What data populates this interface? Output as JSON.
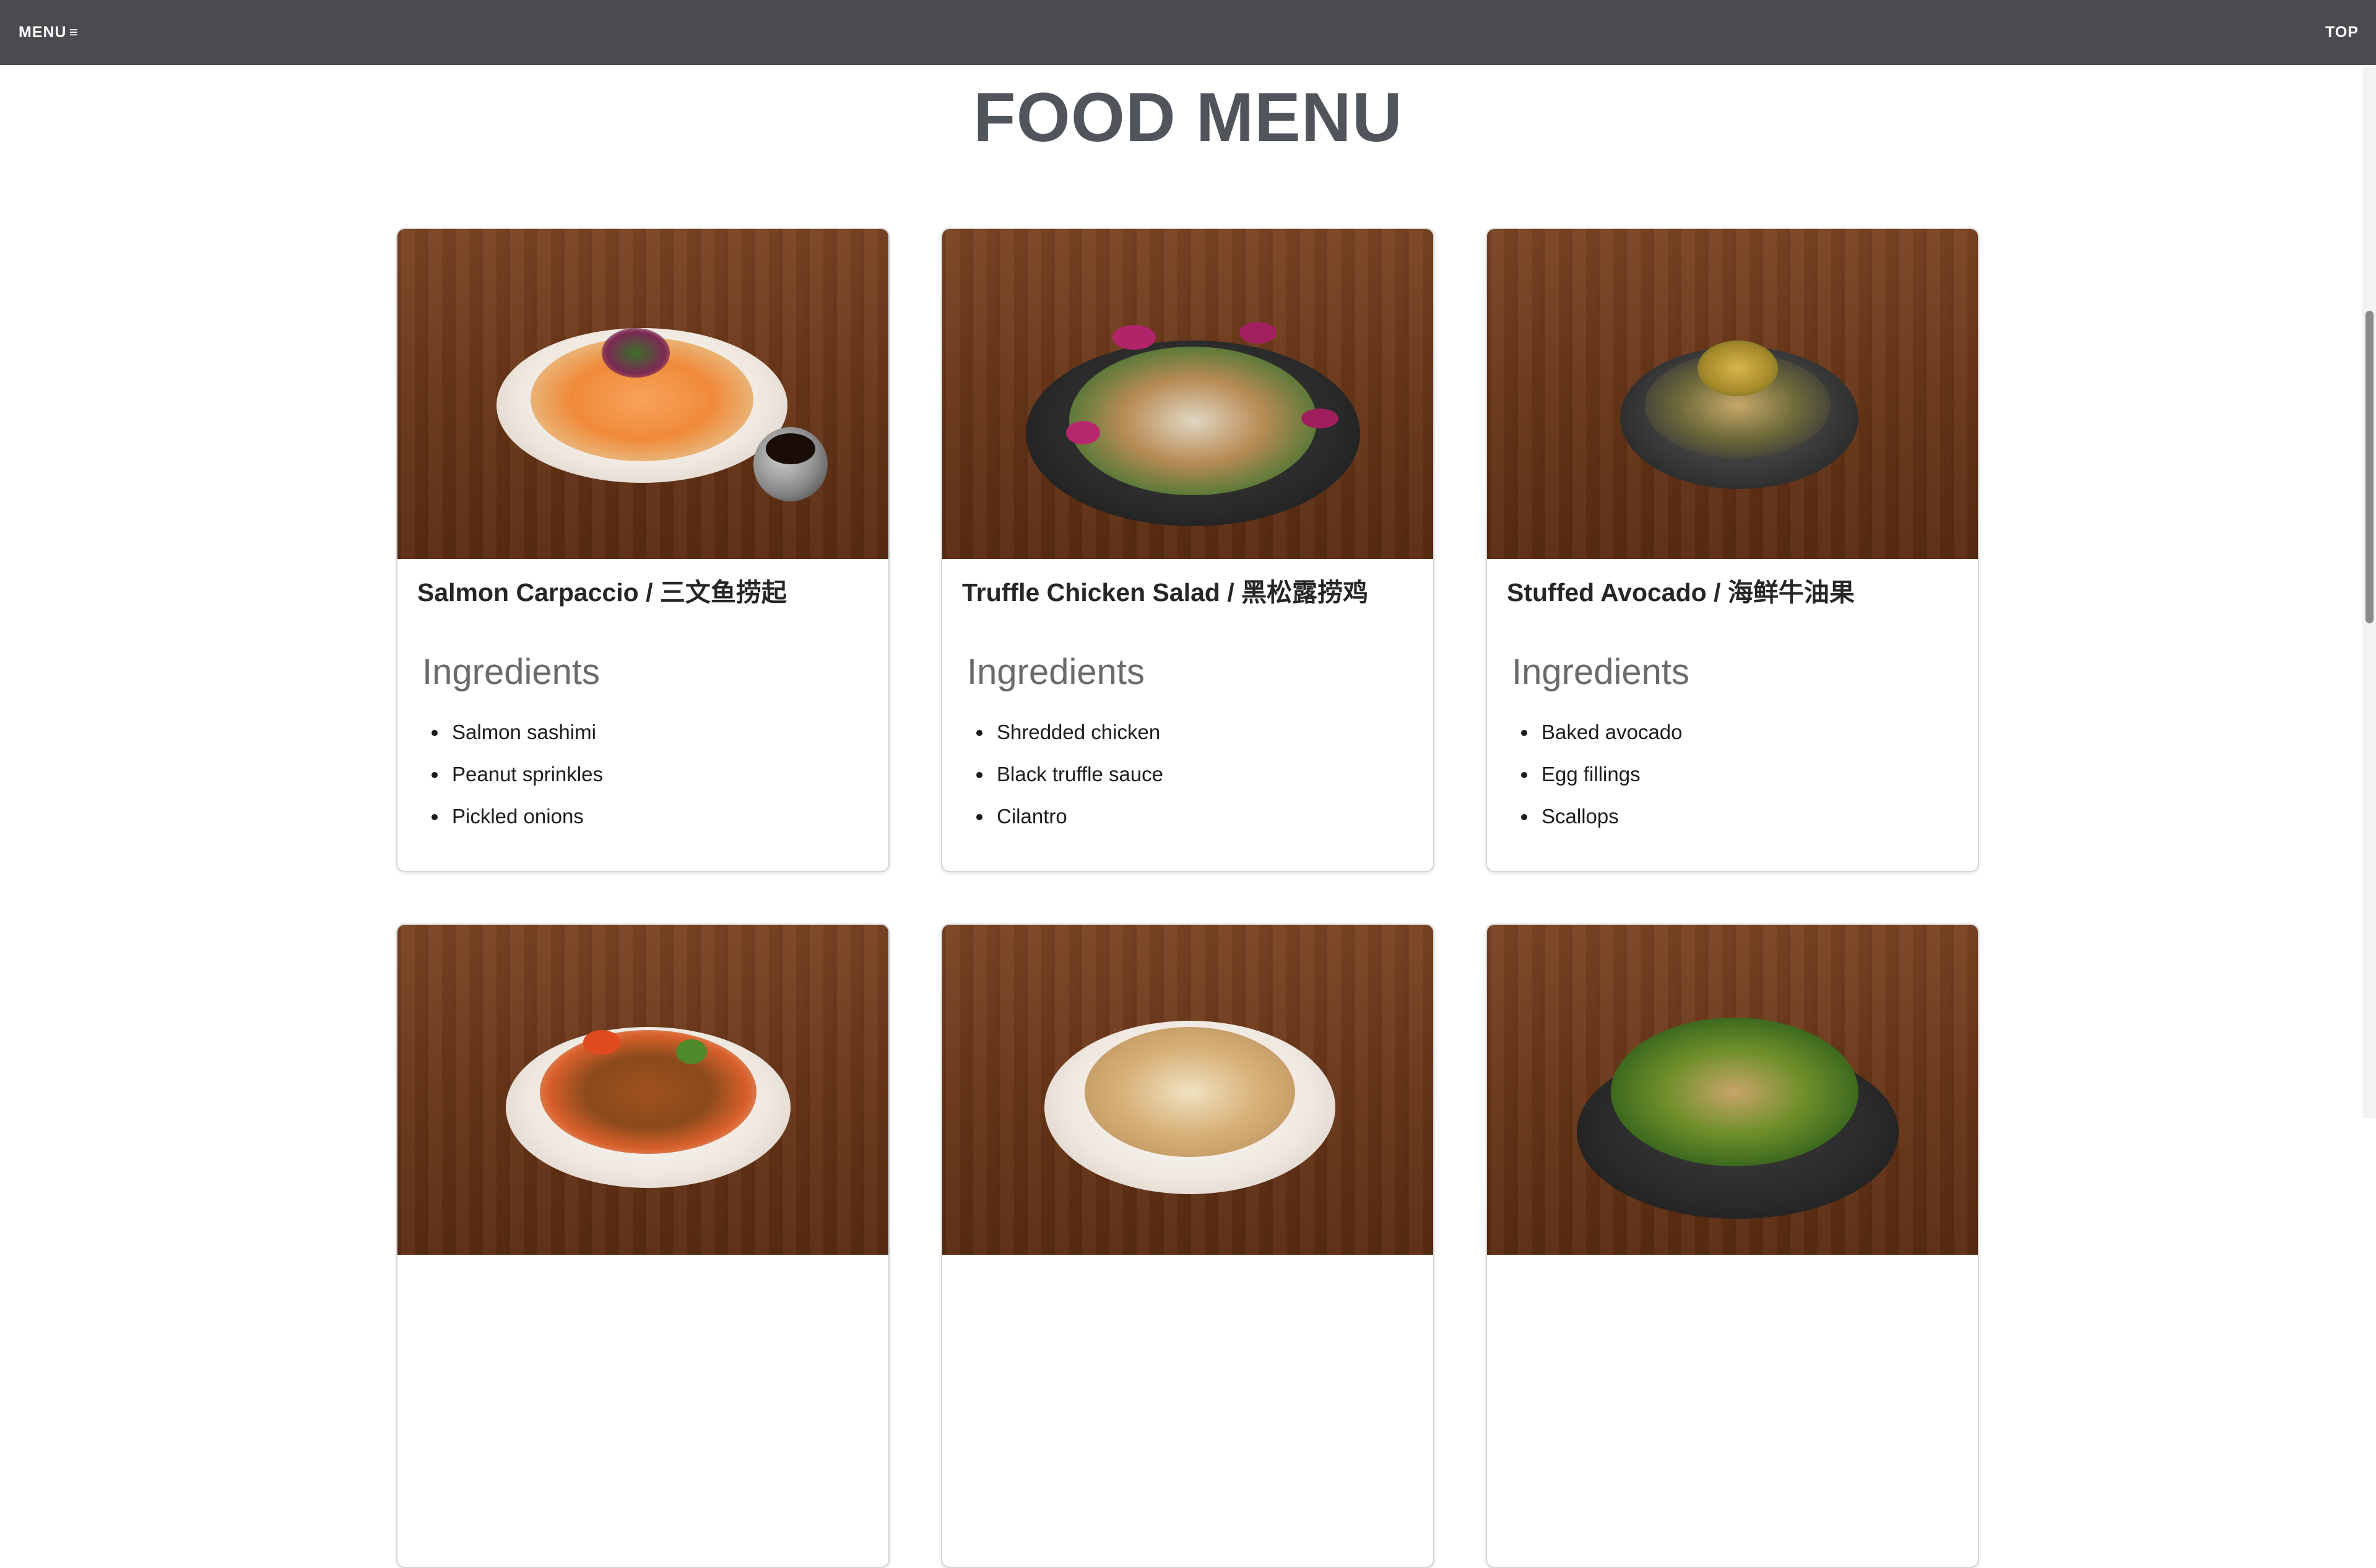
{
  "nav": {
    "menu_label": "MENU",
    "menu_icon": "≡",
    "top_label": "TOP"
  },
  "page": {
    "title": "FOOD MENU"
  },
  "cards": [
    {
      "name": "Salmon Carpaccio / 三文鱼捞起",
      "heading": "Ingredients",
      "ingredients": [
        "Salmon sashimi",
        "Peanut sprinkles",
        "Pickled onions"
      ]
    },
    {
      "name": "Truffle Chicken Salad / 黑松露捞鸡",
      "heading": "Ingredients",
      "ingredients": [
        "Shredded chicken",
        "Black truffle sauce",
        "Cilantro"
      ]
    },
    {
      "name": "Stuffed Avocado / 海鲜牛油果",
      "heading": "Ingredients",
      "ingredients": [
        "Baked avocado",
        "Egg fillings",
        "Scallops"
      ]
    }
  ],
  "colors": {
    "nav_bg": "#4a4b4e",
    "title": "#50545b",
    "wood": "#6a3719"
  }
}
